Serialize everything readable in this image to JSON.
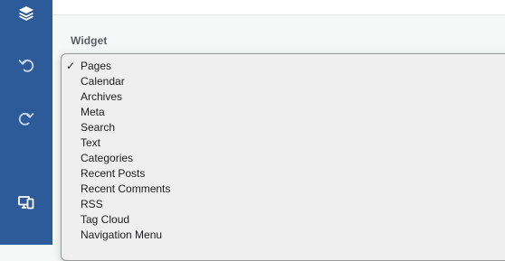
{
  "sidebar": {
    "icons": [
      "layers-icon",
      "undo-icon",
      "redo-icon",
      "responsive-preview-icon"
    ]
  },
  "form": {
    "label": "Widget",
    "select": {
      "selected": "Pages",
      "check_mark": "✓",
      "options": [
        "Pages",
        "Calendar",
        "Archives",
        "Meta",
        "Search",
        "Text",
        "Categories",
        "Recent Posts",
        "Recent Comments",
        "RSS",
        "Tag Cloud",
        "Navigation Menu"
      ]
    }
  },
  "colors": {
    "sidebar_bg": "#2d5b9a",
    "dropdown_bg": "#efefef",
    "label": "#5b5e63"
  }
}
